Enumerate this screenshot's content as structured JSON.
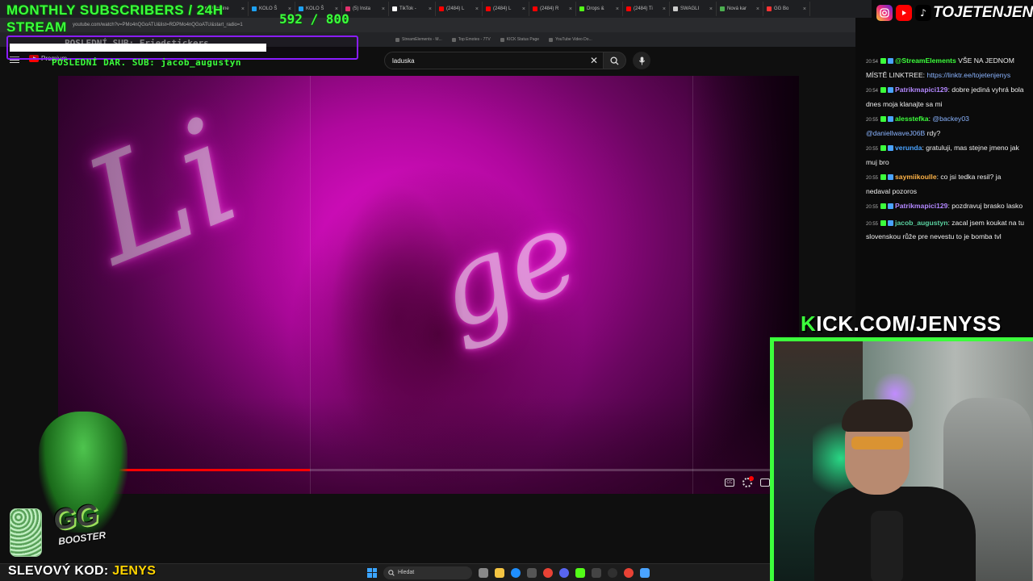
{
  "browser": {
    "tabs": [
      {
        "label": "Ukraine",
        "color": "#888888"
      },
      {
        "label": "KOLO Š",
        "color": "#1da1f2"
      },
      {
        "label": "KOLO Š",
        "color": "#1da1f2"
      },
      {
        "label": "(5) Insta",
        "color": "#e1306c"
      },
      {
        "label": "TikTok -",
        "color": "#ffffff"
      },
      {
        "label": "(2484) L",
        "color": "#ff0000"
      },
      {
        "label": "(2484) L",
        "color": "#ff0000"
      },
      {
        "label": "(2484) R",
        "color": "#ff0000"
      },
      {
        "label": "Drops &",
        "color": "#53fc18"
      },
      {
        "label": "(2484) Ti",
        "color": "#ff0000"
      },
      {
        "label": "SWAGLI",
        "color": "#cccccc"
      },
      {
        "label": "Nová kar",
        "color": "#4caf50"
      },
      {
        "label": "GG Bo",
        "color": "#ff3333"
      }
    ],
    "url": "youtube.com/watch?v=PMo4nQGoATU&list=RDPMo4nQGoATU&start_radio=1",
    "bookmarks": [
      "StreamElements - M...",
      "Top Emotes - 7TV",
      "KICK Status Page",
      "YouTube Video Do..."
    ]
  },
  "youtube": {
    "logo_text": "Premium",
    "search_value": "laduska",
    "progress": 0.34
  },
  "overlay": {
    "subs_title_line1": "MONTHLY SUBSCRIBERS / 24H",
    "subs_title_line2": "STREAM",
    "subs_count": "592 / 800",
    "last_sub_label": "POSLEDNÍ SUB: Friedstickers",
    "last_donation": "POSLEDNÍ DAR. SUB: jacob_augustyn",
    "brand": "TOJETENJENYS",
    "kick_k": "K",
    "kick_rest": "ICK.COM/JENYSS",
    "promo_label": "SLEVOVÝ KOD: ",
    "promo_code": "JENYS",
    "booster_gg": "GG",
    "booster_word": "BOOSTER"
  },
  "chat": {
    "messages": [
      {
        "time": "20:54",
        "user": "@StreamElements",
        "user_color": "#3cff3c",
        "text": " VŠE NA JEDNOM MÍSTĚ LINKTREE: ",
        "link": "https://linktr.ee/tojetenjenys"
      },
      {
        "time": "20:54",
        "user": "Patrikmapici129",
        "user_color": "#b388ff",
        "text": ": dobre jediná vyhrá bola dnes moja klanajte sa mi"
      },
      {
        "time": "20:55",
        "user": "alesstefka",
        "user_color": "#3cff3c",
        "text": ": ",
        "mention": "@backey03 @daniellwaveJ06B",
        "text2": " rdy?"
      },
      {
        "time": "20:55",
        "user": "verunda",
        "user_color": "#4aa3ff",
        "text": ": gratuluji, mas stejne jmeno jak muj bro"
      },
      {
        "time": "20:55",
        "user": "saymiikoulle",
        "user_color": "#ffb347",
        "text": ": co jsi tedka resil? ja nedaval pozoros"
      },
      {
        "time": "20:55",
        "user": "Patrikmapici129",
        "user_color": "#b388ff",
        "text": ": pozdravuj brasko lasko"
      },
      {
        "time": "20:55",
        "user": "jacob_augustyn",
        "user_color": "#5ad1a0",
        "text": ": zacal jsem koukat na tu slovenskou růže pre nevestu to je bomba tvl"
      }
    ]
  },
  "taskbar": {
    "search_placeholder": "Hledat"
  },
  "colors": {
    "accent_green": "#3cff3c",
    "accent_purple": "#8a1cff",
    "youtube_red": "#ff0000"
  }
}
